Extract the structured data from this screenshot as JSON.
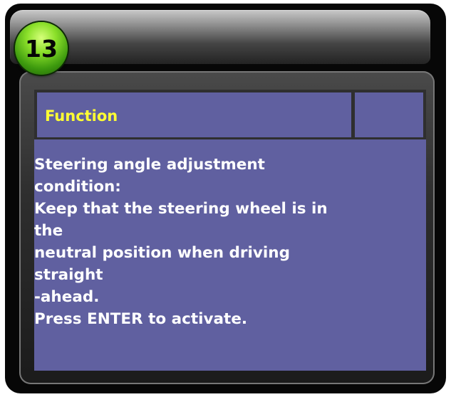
{
  "step_badge": {
    "number": "13"
  },
  "panel": {
    "header_title": "Function",
    "body_lines": [
      "Steering angle adjustment",
      "condition:",
      "Keep that the steering wheel is in",
      "the",
      "neutral position when driving",
      "straight",
      "-ahead.",
      "Press ENTER to activate."
    ]
  },
  "colors": {
    "panel_background": "#6060a0",
    "header_text": "#ffff33",
    "body_text": "#ffffff",
    "badge_green": "#3d9a0e"
  }
}
